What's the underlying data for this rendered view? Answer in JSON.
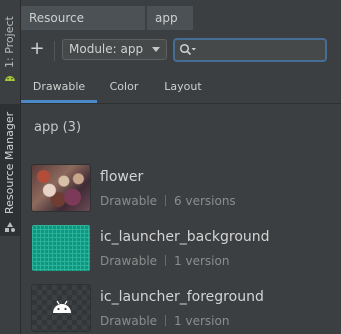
{
  "left_strip": {
    "project_label": "1: Project",
    "resource_manager_label": "Resource Manager"
  },
  "tabs": [
    {
      "label": "Resource Manager"
    },
    {
      "label": "app"
    }
  ],
  "toolbar": {
    "add_label": "+",
    "module_select": "Module: app",
    "search_value": ""
  },
  "categories": [
    {
      "label": "Drawable",
      "selected": true
    },
    {
      "label": "Color"
    },
    {
      "label": "Layout"
    }
  ],
  "section": {
    "title": "app (3)"
  },
  "resources": [
    {
      "name": "flower",
      "type": "Drawable",
      "versions": "6 versions"
    },
    {
      "name": "ic_launcher_background",
      "type": "Drawable",
      "versions": "1 version"
    },
    {
      "name": "ic_launcher_foreground",
      "type": "Drawable",
      "versions": "1 version"
    }
  ],
  "colors": {
    "background": "#3c3f41",
    "accent": "#4a88c7",
    "android_green": "#a4c639"
  }
}
